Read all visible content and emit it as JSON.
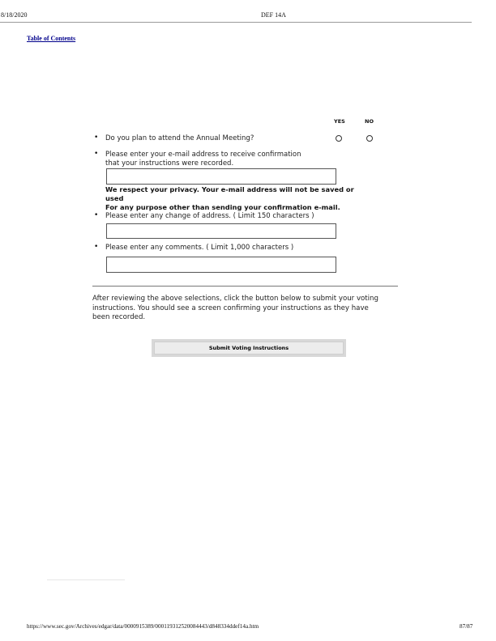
{
  "header": {
    "date": "8/18/2020",
    "form_type": "DEF 14A",
    "toc_link": "Table of Contents"
  },
  "columns": {
    "yes": "YES",
    "no": "NO"
  },
  "questions": [
    {
      "label": "Do you plan to attend the Annual Meeting?"
    },
    {
      "label_line1": "Please enter your e-mail address to receive confirmation",
      "label_line2": "that your instructions were recorded."
    },
    {
      "label": "Please enter any change of address. ( Limit 150 characters )"
    },
    {
      "label": "Please enter any comments. ( Limit 1,000 characters )"
    }
  ],
  "privacy": {
    "line1": "We respect your privacy.  Your e-mail address will not be saved or used",
    "line2": "For any purpose other than sending your confirmation e-mail."
  },
  "instructions": "After reviewing the above selections, click the button below to submit your voting instructions.  You should see a screen confirming your instructions as they have been recorded.",
  "submit_label": "Submit Voting Instructions",
  "footer": {
    "url": "https://www.sec.gov/Archives/edgar/data/0000915389/000119312520084443/d848334ddef14a.htm",
    "page": "87/87"
  }
}
